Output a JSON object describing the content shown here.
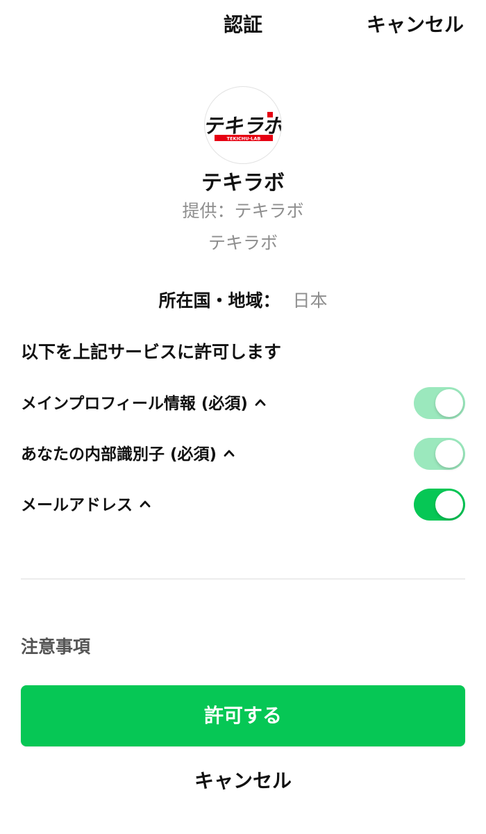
{
  "header": {
    "title": "認証",
    "cancel_label": "キャンセル"
  },
  "app": {
    "logo_text": "テキラボ",
    "logo_subtext": "TEKICHU-LAB",
    "name": "テキラボ",
    "provider": "提供：テキラボ",
    "description": "テキラボ"
  },
  "region": {
    "label": "所在国・地域：",
    "value": "日本"
  },
  "permissions": {
    "heading": "以下を上記サービスに許可します",
    "items": [
      {
        "label": "メインプロフィール情報 (必須)",
        "enabled": true,
        "required": true
      },
      {
        "label": "あなたの内部識別子 (必須)",
        "enabled": true,
        "required": true
      },
      {
        "label": "メールアドレス",
        "enabled": true,
        "required": false
      }
    ]
  },
  "notes_label": "注意事項",
  "buttons": {
    "allow_label": "許可する",
    "cancel_label": "キャンセル"
  },
  "colors": {
    "primary_green": "#06c755",
    "toggle_disabled_green": "#9be8bd",
    "logo_red": "#e60012",
    "secondary_text": "#8e8e8e"
  }
}
